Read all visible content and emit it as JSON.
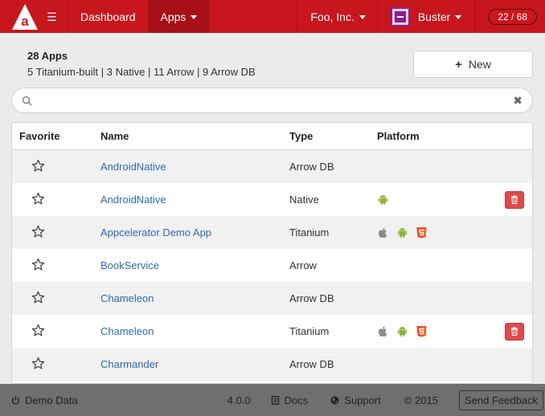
{
  "nav": {
    "logo_letter": "a",
    "dashboard": "Dashboard",
    "apps": "Apps",
    "org": "Foo, Inc.",
    "user": "Buster",
    "count": "22 / 68"
  },
  "summary": {
    "title": "28 Apps",
    "subtitle": "5 Titanium-built | 3 Native | 11 Arrow | 9 Arrow DB"
  },
  "new_button": {
    "label": "New"
  },
  "search": {
    "placeholder": "",
    "value": ""
  },
  "table": {
    "headers": {
      "favorite": "Favorite",
      "name": "Name",
      "type": "Type",
      "platform": "Platform"
    },
    "rows": [
      {
        "name": "AndroidNative",
        "type": "Arrow DB",
        "platforms": [],
        "deletable": false
      },
      {
        "name": "AndroidNative",
        "type": "Native",
        "platforms": [
          "android"
        ],
        "deletable": true
      },
      {
        "name": "Appcelerator Demo App",
        "type": "Titanium",
        "platforms": [
          "apple",
          "android",
          "html5"
        ],
        "deletable": false
      },
      {
        "name": "BookService",
        "type": "Arrow",
        "platforms": [],
        "deletable": false
      },
      {
        "name": "Chameleon",
        "type": "Arrow DB",
        "platforms": [],
        "deletable": false
      },
      {
        "name": "Chameleon",
        "type": "Titanium",
        "platforms": [
          "apple",
          "android",
          "html5"
        ],
        "deletable": true
      },
      {
        "name": "Charmander",
        "type": "Arrow DB",
        "platforms": [],
        "deletable": false
      }
    ]
  },
  "footer": {
    "demo_data": "Demo Data",
    "version": "4.0.0",
    "docs": "Docs",
    "support": "Support",
    "copyright": "© 2015",
    "feedback": "Send Feedback"
  },
  "colors": {
    "brand_red": "#c8161d",
    "link_blue": "#2d6ab4",
    "android_green": "#8cb43a",
    "html5_orange": "#e44d26",
    "apple_gray": "#8a8a8a",
    "delete_red": "#dd4b4b"
  }
}
